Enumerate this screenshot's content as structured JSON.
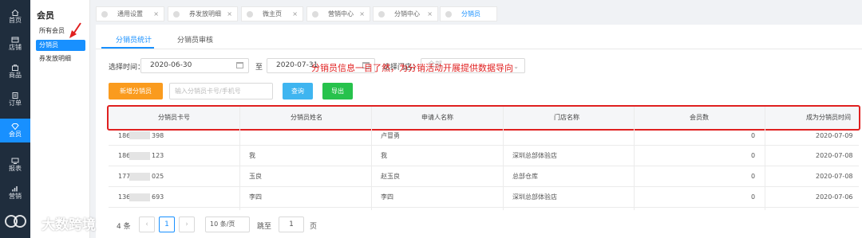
{
  "nav": {
    "items": [
      {
        "label": "首页",
        "icon": "home-icon"
      },
      {
        "label": "店铺",
        "icon": "store-icon"
      },
      {
        "label": "商品",
        "icon": "goods-icon"
      },
      {
        "label": "订单",
        "icon": "order-icon"
      },
      {
        "label": "会员",
        "icon": "member-icon"
      },
      {
        "label": "报表",
        "icon": "report-icon"
      },
      {
        "label": "营销",
        "icon": "marketing-icon"
      }
    ]
  },
  "sidebar": {
    "title": "会员",
    "items": [
      {
        "label": "所有会员"
      },
      {
        "label": "分销员"
      },
      {
        "label": "券发放明细"
      }
    ]
  },
  "tabs": [
    {
      "label": "通用设置"
    },
    {
      "label": "券发放明细"
    },
    {
      "label": "微主页"
    },
    {
      "label": "营销中心"
    },
    {
      "label": "分销中心"
    },
    {
      "label": "分销员"
    }
  ],
  "subtabs": [
    "分销员统计",
    "分销员审核"
  ],
  "filter": {
    "time_label": "选择时间：",
    "start_date": "2020-06-30",
    "to_label": "至",
    "end_date": "2020-07-31",
    "store_label": "选择门店：",
    "store_placeholder": "全部"
  },
  "actions": {
    "add_label": "新增分销员",
    "search_placeholder": "输入分销员卡号/手机号",
    "query_label": "查询",
    "export_label": "导出"
  },
  "annotation": "分销员信息一目了然，为分销活动开展提供数据导向",
  "table": {
    "headers": [
      "分销员卡号",
      "分销员姓名",
      "申请人名称",
      "门店名称",
      "会员数",
      "成为分销员时间"
    ],
    "rows": [
      [
        "186",
        "398",
        "",
        "卢冒勇",
        "",
        "0",
        "2020-07-09"
      ],
      [
        "186",
        "123",
        "我",
        "我",
        "深圳总部体验店",
        "0",
        "2020-07-08"
      ],
      [
        "177",
        "025",
        "玉良",
        "赵玉良",
        "总部仓库",
        "0",
        "2020-07-08"
      ],
      [
        "136",
        "693",
        "李四",
        "李四",
        "深圳总部体验店",
        "0",
        "2020-07-06"
      ]
    ]
  },
  "pagination": {
    "total": "4 条",
    "current_page": "1",
    "page_size": "10 条/页",
    "jump_label": "跳至",
    "jump_value": "1",
    "page_suffix": "页"
  },
  "watermark": "大数跨境",
  "colors": {
    "accent": "#1890ff",
    "orange": "#fa9b1e",
    "green": "#27c24c",
    "cyan": "#3fb5f0",
    "annotation": "#e02020"
  }
}
